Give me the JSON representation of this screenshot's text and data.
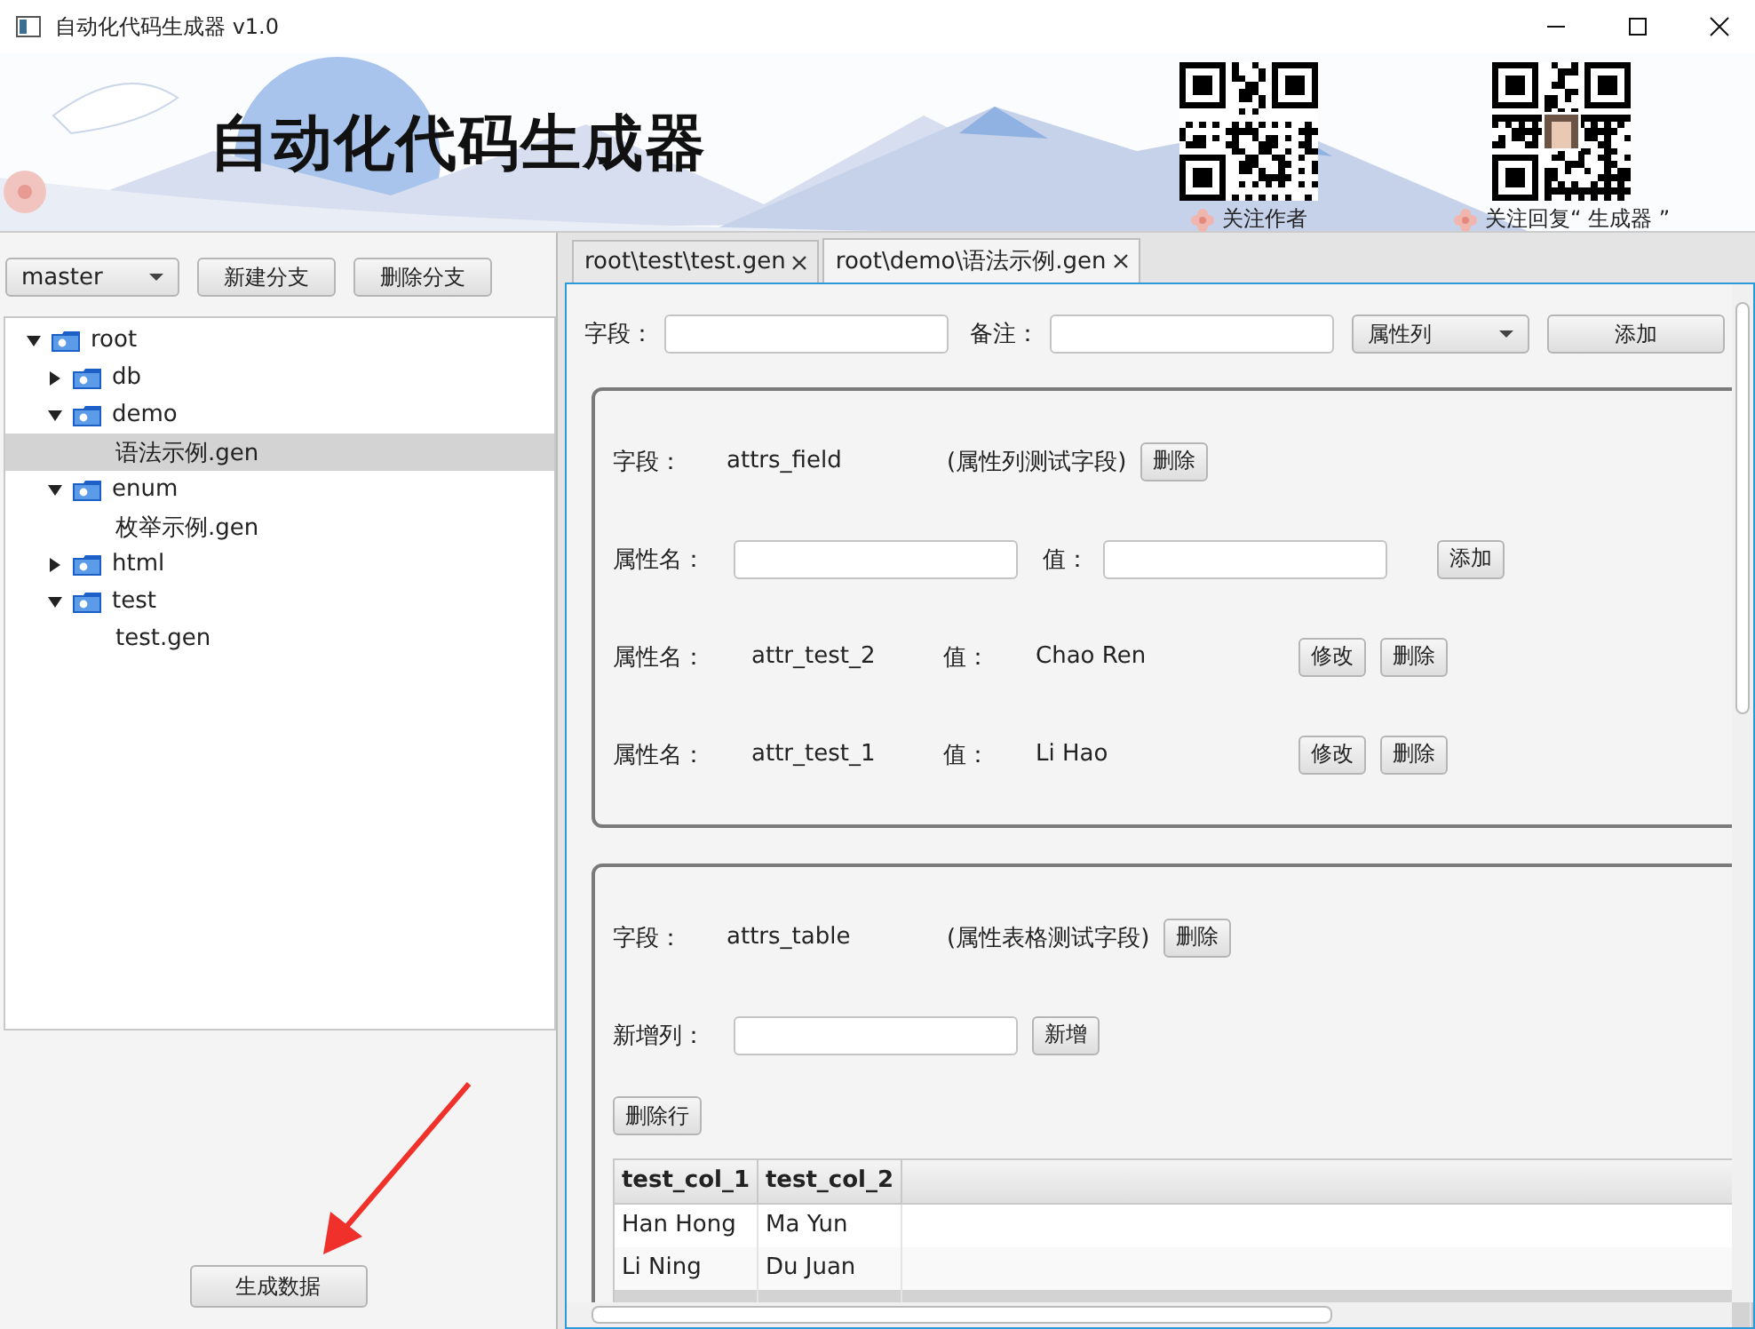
{
  "window": {
    "title": "自动化代码生成器 v1.0"
  },
  "banner": {
    "title": "自动化代码生成器",
    "qr_codes": [
      {
        "caption": "关注作者",
        "kind": "plain"
      },
      {
        "caption": "关注回复“ 生成器 ”",
        "kind": "avatar"
      }
    ]
  },
  "branch": {
    "value": "master"
  },
  "branch_buttons": [
    "新建分支",
    "删除分支"
  ],
  "tree": [
    {
      "label": "root",
      "kind": "folder",
      "expanded": true,
      "selected": false,
      "children": [
        {
          "label": "db",
          "kind": "folder",
          "expanded": false,
          "selected": false
        },
        {
          "label": "demo",
          "kind": "folder",
          "expanded": true,
          "selected": false,
          "children": [
            {
              "label": "语法示例.gen",
              "kind": "file",
              "selected": true
            }
          ]
        },
        {
          "label": "enum",
          "kind": "folder",
          "expanded": true,
          "selected": false,
          "children": [
            {
              "label": "枚举示例.gen",
              "kind": "file",
              "selected": false
            }
          ]
        },
        {
          "label": "html",
          "kind": "folder",
          "expanded": false,
          "selected": false
        },
        {
          "label": "test",
          "kind": "folder",
          "expanded": true,
          "selected": false,
          "children": [
            {
              "label": "test.gen",
              "kind": "file",
              "selected": false
            }
          ]
        }
      ]
    }
  ],
  "generate_button": "生成数据",
  "tabs": [
    {
      "label": "root\\test\\test.gen",
      "selected": false
    },
    {
      "label": "root\\demo\\语法示例.gen",
      "selected": true
    }
  ],
  "form": {
    "field_label": "字段：",
    "remark_label": "备注：",
    "type_select": "属性列",
    "add_button": "添加"
  },
  "cards": [
    {
      "kind": "attrs",
      "field_label": "字段：",
      "field_name": "attrs_field",
      "comment": "(属性列测试字段)",
      "delete_button": "删除",
      "new_attr": {
        "name_label": "属性名：",
        "value_label": "值：",
        "button": "添加"
      },
      "attributes": [
        {
          "name_label": "属性名：",
          "name": "attr_test_2",
          "value_label": "值：",
          "value": "Chao Ren",
          "edit_button": "修改",
          "delete_button": "删除"
        },
        {
          "name_label": "属性名：",
          "name": "attr_test_1",
          "value_label": "值：",
          "value": "Li Hao",
          "edit_button": "修改",
          "delete_button": "删除"
        }
      ]
    },
    {
      "kind": "table",
      "field_label": "字段：",
      "field_name": "attrs_table",
      "comment": "(属性表格测试字段)",
      "delete_button": "删除",
      "new_column": {
        "label": "新增列：",
        "button": "新增"
      },
      "delete_row_button": "删除行",
      "table": {
        "columns": [
          "test_col_1",
          "test_col_2"
        ],
        "rows": [
          [
            "Han Hong",
            "Ma Yun"
          ],
          [
            "Li Ning",
            "Du Juan"
          ]
        ]
      }
    }
  ]
}
